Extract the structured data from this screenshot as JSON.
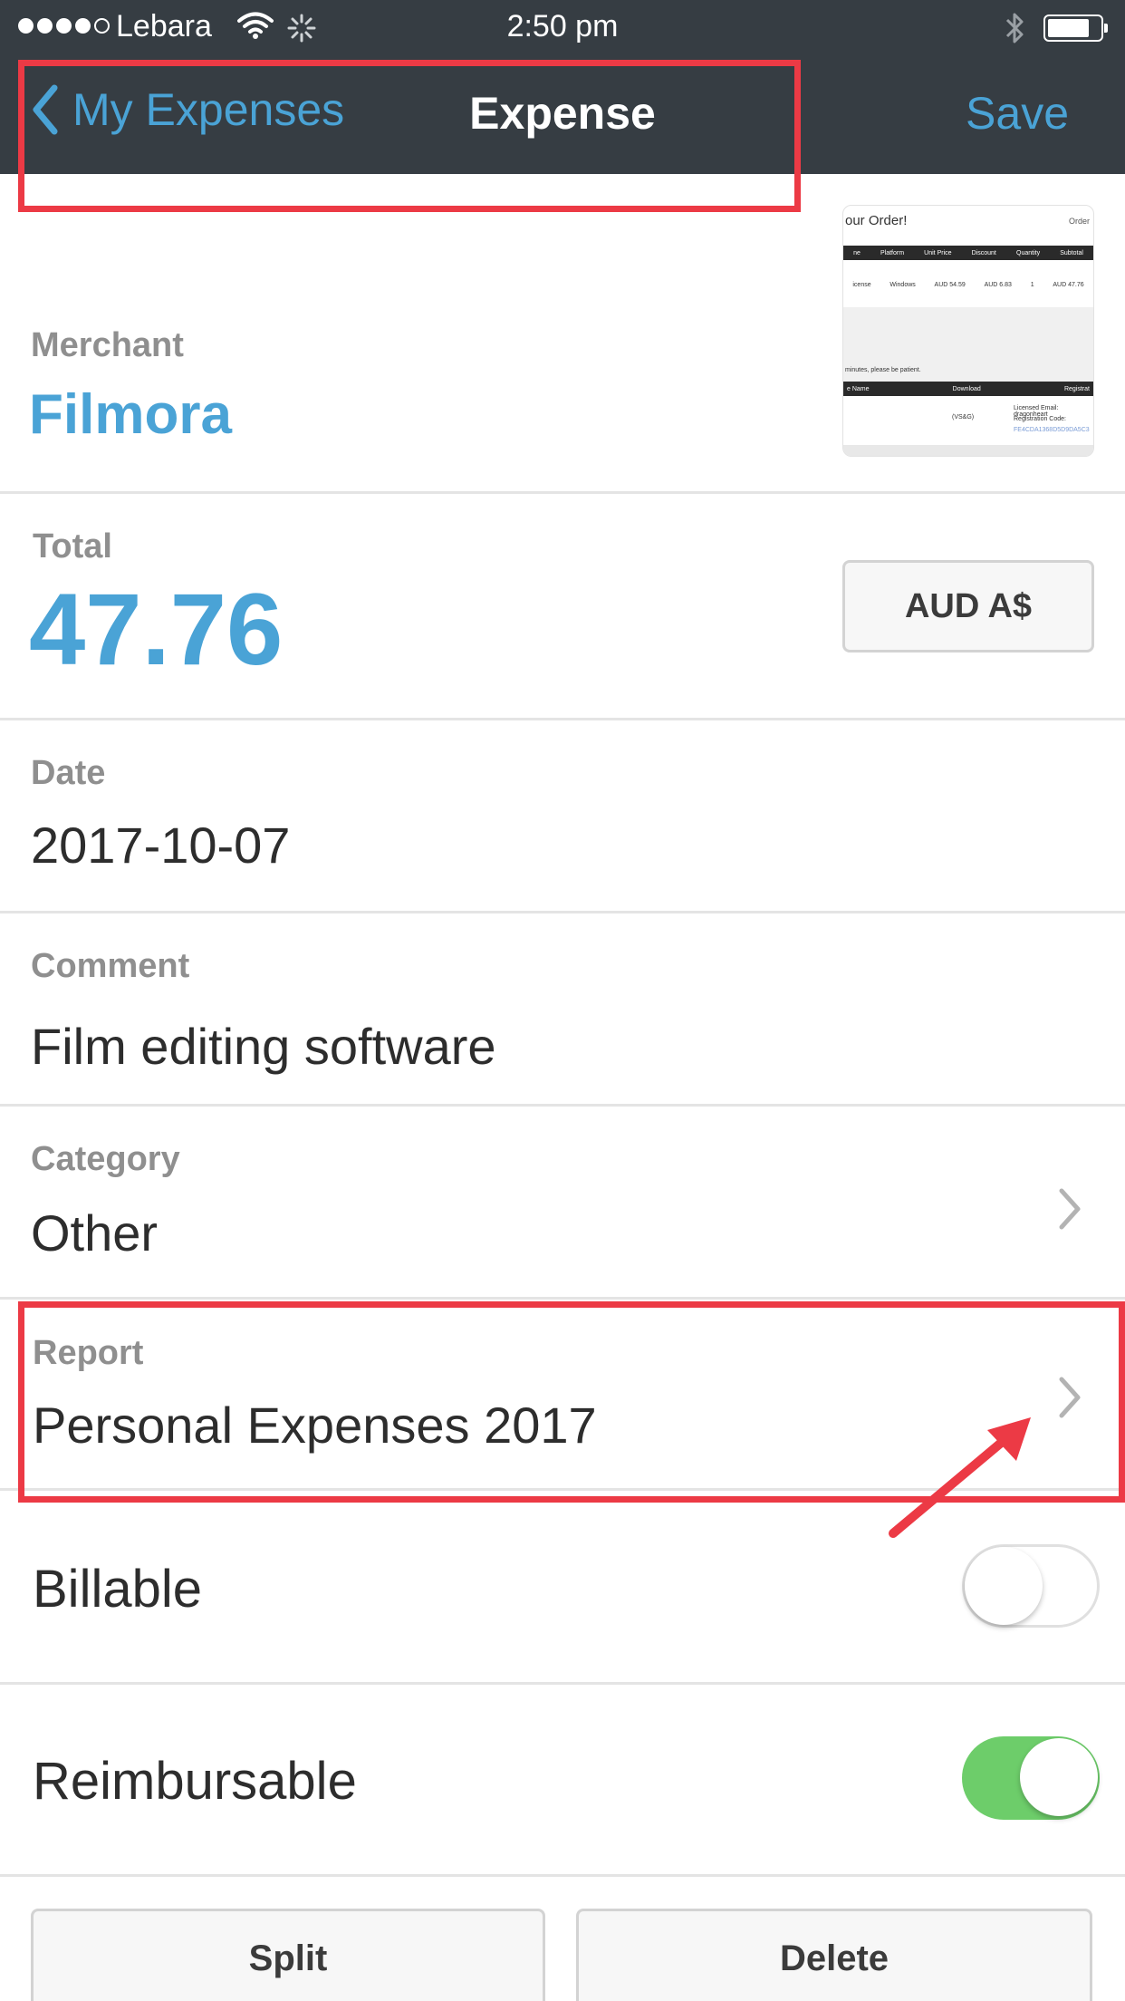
{
  "status_bar": {
    "carrier": "Lebara",
    "time": "2:50 pm",
    "battery_level": 0.8
  },
  "nav": {
    "back_label": "My Expenses",
    "title": "Expense",
    "save_label": "Save"
  },
  "receipt": {
    "title": "our Order!",
    "title_right": "Order",
    "headers": [
      "ne",
      "Platform",
      "Unit Price",
      "Discount",
      "Quantity",
      "Subtotal"
    ],
    "row": [
      "icense",
      "Windows",
      "AUD 54.59",
      "AUD 6.83",
      "1",
      "AUD 47.76"
    ],
    "note": "minutes, please be patient.",
    "headers2": [
      "e Name",
      "Download",
      "Registrat"
    ],
    "row2_left": "(VS&G)",
    "row2_right1": "Licensed Email: dragonheart",
    "row2_right2": "Registration Code:",
    "row2_right3": "FE4CDA1368D5D9DA5C3"
  },
  "merchant": {
    "label": "Merchant",
    "value": "Filmora"
  },
  "total": {
    "label": "Total",
    "value": "47.76",
    "currency": "AUD A$"
  },
  "date": {
    "label": "Date",
    "value": "2017-10-07"
  },
  "comment": {
    "label": "Comment",
    "value": "Film editing software"
  },
  "category": {
    "label": "Category",
    "value": "Other"
  },
  "report": {
    "label": "Report",
    "value": "Personal Expenses 2017"
  },
  "billable": {
    "label": "Billable",
    "state": "off"
  },
  "reimbursable": {
    "label": "Reimbursable",
    "state": "on"
  },
  "actions": {
    "split_label": "Split",
    "delete_label": "Delete"
  },
  "colors": {
    "accent": "#4aa3d6",
    "nav_bg": "#363d43",
    "annotation": "#ec3a45",
    "toggle_on": "#6dcd6a"
  }
}
